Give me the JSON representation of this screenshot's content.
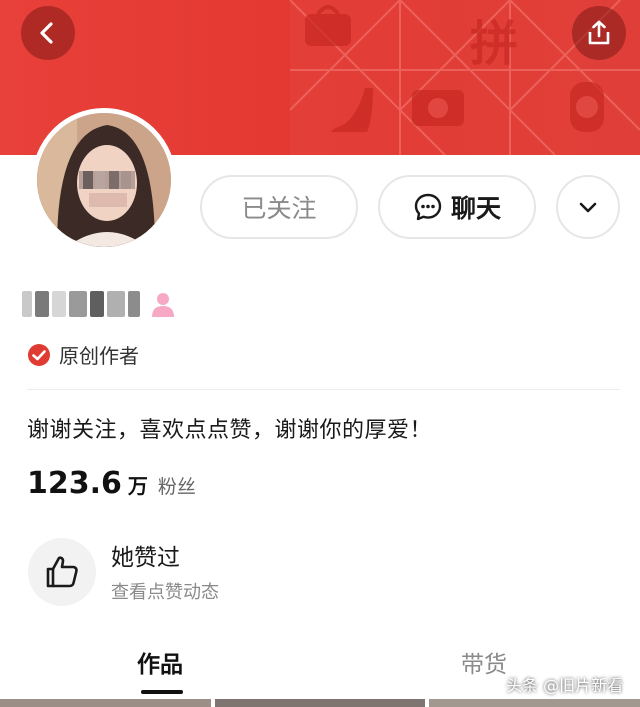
{
  "header": {
    "back_icon": "chevron-left-icon",
    "share_icon": "share-icon",
    "banner_text": "拼"
  },
  "profile": {
    "follow_label": "已关注",
    "chat_label": "聊天",
    "more_icon": "chevron-down-icon",
    "verify_label": "原创作者",
    "bio": "谢谢关注，喜欢点点赞，谢谢你的厚爱！",
    "fans_count": "123.6",
    "fans_unit": "万",
    "fans_label": "粉丝"
  },
  "liked": {
    "title": "她赞过",
    "subtitle": "查看点赞动态"
  },
  "tabs": [
    {
      "label": "作品",
      "active": true
    },
    {
      "label": "带货",
      "active": false
    }
  ],
  "watermark": "头条 @旧片新看",
  "colors": {
    "brand_red": "#e2362f",
    "verify_red": "#e03b32",
    "gender_pink": "#f7a8c4"
  }
}
